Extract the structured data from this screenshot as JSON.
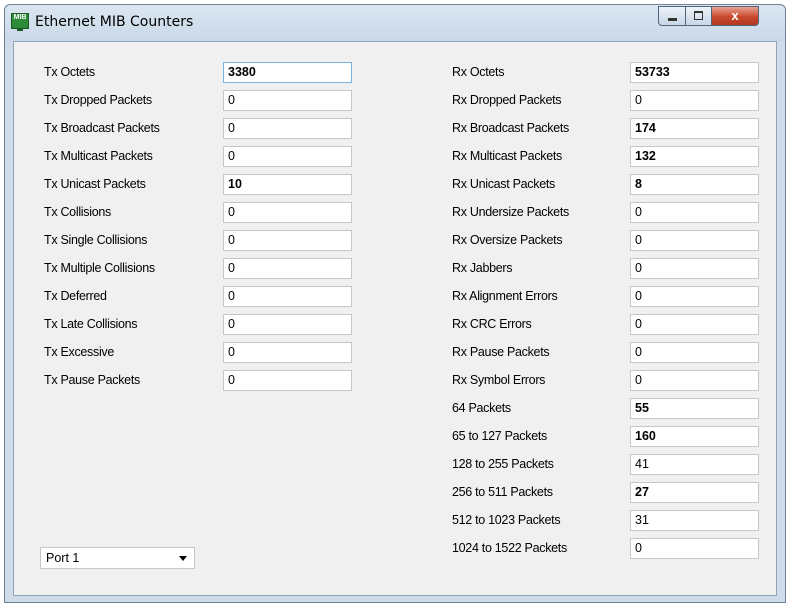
{
  "window": {
    "title": "Ethernet MIB Counters",
    "close_glyph": "x"
  },
  "tx": [
    {
      "label": "Tx Octets",
      "value": "3380",
      "bold": true
    },
    {
      "label": "Tx Dropped Packets",
      "value": "0",
      "bold": false
    },
    {
      "label": "Tx Broadcast Packets",
      "value": "0",
      "bold": false
    },
    {
      "label": "Tx Multicast Packets",
      "value": "0",
      "bold": false
    },
    {
      "label": "Tx Unicast Packets",
      "value": "10",
      "bold": true
    },
    {
      "label": "Tx Collisions",
      "value": "0",
      "bold": false
    },
    {
      "label": "Tx Single Collisions",
      "value": "0",
      "bold": false
    },
    {
      "label": "Tx Multiple Collisions",
      "value": "0",
      "bold": false
    },
    {
      "label": "Tx Deferred",
      "value": "0",
      "bold": false
    },
    {
      "label": "Tx Late Collisions",
      "value": "0",
      "bold": false
    },
    {
      "label": "Tx Excessive",
      "value": "0",
      "bold": false
    },
    {
      "label": "Tx Pause Packets",
      "value": "0",
      "bold": false
    }
  ],
  "rx": [
    {
      "label": "Rx Octets",
      "value": "53733",
      "bold": true
    },
    {
      "label": "Rx Dropped Packets",
      "value": "0",
      "bold": false
    },
    {
      "label": "Rx Broadcast Packets",
      "value": "174",
      "bold": true
    },
    {
      "label": "Rx Multicast Packets",
      "value": "132",
      "bold": true
    },
    {
      "label": "Rx Unicast Packets",
      "value": "8",
      "bold": true
    },
    {
      "label": "Rx Undersize Packets",
      "value": "0",
      "bold": false
    },
    {
      "label": "Rx Oversize Packets",
      "value": "0",
      "bold": false
    },
    {
      "label": "Rx Jabbers",
      "value": "0",
      "bold": false
    },
    {
      "label": "Rx Alignment Errors",
      "value": "0",
      "bold": false
    },
    {
      "label": "Rx CRC Errors",
      "value": "0",
      "bold": false
    },
    {
      "label": "Rx Pause Packets",
      "value": "0",
      "bold": false
    },
    {
      "label": "Rx Symbol Errors",
      "value": "0",
      "bold": false
    },
    {
      "label": "64 Packets",
      "value": "55",
      "bold": true
    },
    {
      "label": "65 to 127 Packets",
      "value": "160",
      "bold": true
    },
    {
      "label": "128 to 255 Packets",
      "value": "41",
      "bold": false
    },
    {
      "label": "256 to 511 Packets",
      "value": "27",
      "bold": true
    },
    {
      "label": "512 to 1023 Packets",
      "value": "31",
      "bold": false
    },
    {
      "label": "1024 to 1522 Packets",
      "value": "0",
      "bold": false
    }
  ],
  "port_select": {
    "selected": "Port 1"
  }
}
